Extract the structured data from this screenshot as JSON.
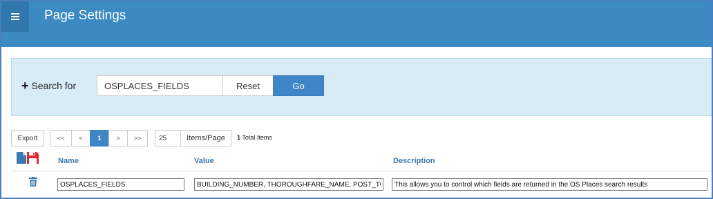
{
  "header": {
    "title": "Page Settings",
    "menu_icon": "hamburger-menu-icon"
  },
  "search": {
    "label": "Search for",
    "value": "OSPLACES_FIELDS",
    "reset_label": "Reset",
    "go_label": "Go",
    "expand_icon": "plus-icon"
  },
  "toolbar": {
    "export_label": "Export",
    "pager": {
      "first": "<<",
      "prev": "<",
      "current": "1",
      "next": ">",
      "last": ">>"
    },
    "items_per_page_value": "25",
    "items_per_page_label": "Items/Page",
    "total_count": "1",
    "total_label": "Total Items"
  },
  "table": {
    "header_icons": [
      "new-document-icon",
      "save-icon"
    ],
    "columns": {
      "name": "Name",
      "value": "Value",
      "description": "Description"
    },
    "rows": [
      {
        "row_icon": "trash-icon",
        "name": "OSPLACES_FIELDS",
        "value": "BUILDING_NUMBER, THOROUGHFARE_NAME, POST_TOWN",
        "description": "This allows you to control which fields are returned in the OS Places search results"
      }
    ]
  },
  "colors": {
    "header": "#3b8bc2",
    "menu_button": "#2f77ad",
    "search_panel": "#d8ecf5",
    "primary_button": "#3f86c8",
    "column_header_text": "#3a78b0",
    "save_icon": "#e0262d"
  }
}
